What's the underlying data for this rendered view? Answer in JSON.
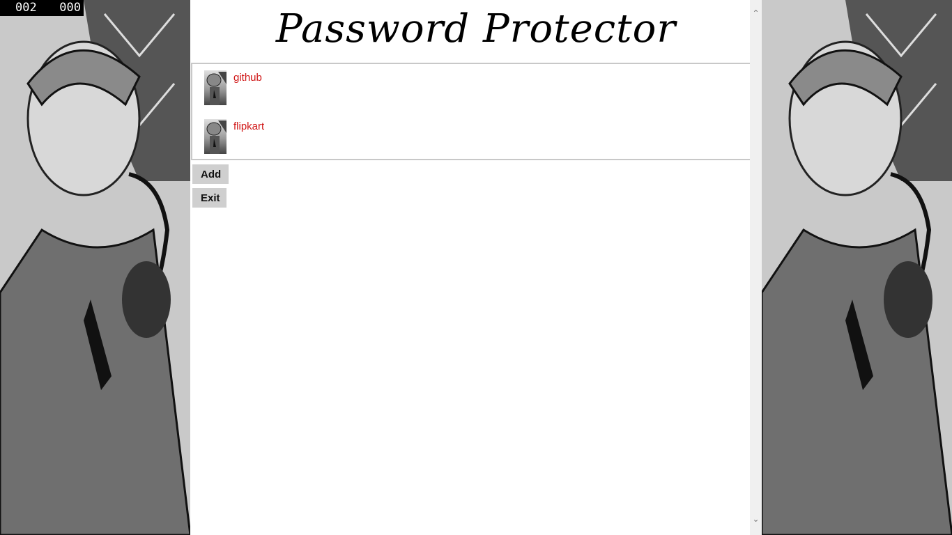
{
  "fps": {
    "left": "002",
    "right": "000"
  },
  "app": {
    "title": "Password Protector"
  },
  "entries": [
    {
      "label": "github",
      "icon": "detective-thumbnail-icon"
    },
    {
      "label": "flipkart",
      "icon": "detective-thumbnail-icon"
    }
  ],
  "buttons": {
    "add": "Add",
    "exit": "Exit"
  },
  "scroll": {
    "up": "⌃",
    "down": "⌄"
  },
  "colors": {
    "entry_text": "#d01616",
    "button_bg": "#cfcfcf",
    "title": "#000000"
  },
  "artwork": {
    "left": "sherlock-holmes-illustration",
    "right": "sherlock-holmes-illustration"
  }
}
